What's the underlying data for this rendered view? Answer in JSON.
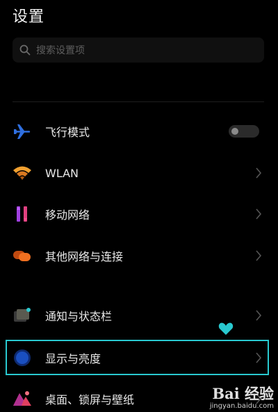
{
  "header": {
    "title": "设置"
  },
  "search": {
    "placeholder": "搜索设置项"
  },
  "settings": {
    "items": [
      {
        "label": "飞行模式",
        "icon": "airplane-icon",
        "control": "toggle",
        "toggle_on": false
      },
      {
        "label": "WLAN",
        "icon": "wifi-icon",
        "control": "chevron"
      },
      {
        "label": "移动网络",
        "icon": "mobile-network-icon",
        "control": "chevron"
      },
      {
        "label": "其他网络与连接",
        "icon": "other-connections-icon",
        "control": "chevron"
      },
      {
        "label": "通知与状态栏",
        "icon": "notification-icon",
        "control": "chevron"
      },
      {
        "label": "显示与亮度",
        "icon": "display-brightness-icon",
        "control": "chevron",
        "highlighted": true
      },
      {
        "label": "桌面、锁屏与壁纸",
        "icon": "wallpaper-icon",
        "control": "chevron"
      }
    ]
  },
  "watermark": {
    "brand": "Bai 经验",
    "site": "jingyan.baidu.com"
  },
  "colors": {
    "background": "#000000",
    "highlight": "#29c9d0",
    "airplane": "#2f6fe0",
    "wifi": "#f0a030",
    "mobile_network": "#a040e0",
    "other_connections": "#f07020",
    "display": "#1a4fc0",
    "wallpaper": "#e04060"
  }
}
